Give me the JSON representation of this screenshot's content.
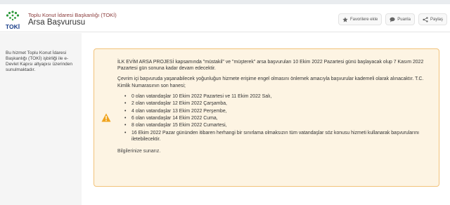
{
  "header": {
    "institution": "Toplu Konut İdaresi Başkanlığı (TOKİ)",
    "title": "Arsa Başvurusu",
    "logo_text": "TOKİ",
    "actions": [
      {
        "label": "Favorilere ekle",
        "icon": "star-icon"
      },
      {
        "label": "Puanla",
        "icon": "speech-bubble-icon"
      },
      {
        "label": "Paylaş",
        "icon": "share-icon"
      }
    ]
  },
  "sidebar": {
    "text": "Bu hizmet Toplu Konut İdaresi Başkanlığı (TOKİ) işbirliği ile e-Devlet Kapısı altyapısı üzerinden sunulmaktadır."
  },
  "notice": {
    "icon": "warning-icon",
    "accent_color": "#f0a31c",
    "paragraph1": "İLK EVİM ARSA PROJESİ kapsamında \"müstakil\" ve \"müşterek\" arsa başvuruları 10 Ekim 2022 Pazartesi günü başlayacak olup 7 Kasım 2022 Pazartesi gün sonuna kadar devam edecektir.",
    "paragraph2": "Çevrim içi başvuruda yaşanabilecek yoğunluğun hizmete erişime engel olmasını önlemek amacıyla başvurular kademeli olarak alınacaktır. T.C. Kimlik Numarasının son hanesi;",
    "bullets": [
      "0 olan vatandaşlar 10 Ekim 2022 Pazartesi ve 11 Ekim 2022 Salı,",
      "2 olan vatandaşlar 12 Ekim 2022 Çarşamba,",
      "4 olan vatandaşlar 13 Ekim 2022 Perşembe,",
      "6 olan vatandaşlar 14 Ekim 2022 Cuma,",
      "8 olan vatandaşlar 15 Ekim 2022 Cumartesi,",
      "16 Ekim 2022 Pazar gününden itibaren herhangi bir sınırlama olmaksızın tüm vatandaşlar söz konusu hizmeti kullanarak başvurularını iletebilecektir."
    ],
    "closing": "Bilgilerinize sunarız."
  }
}
